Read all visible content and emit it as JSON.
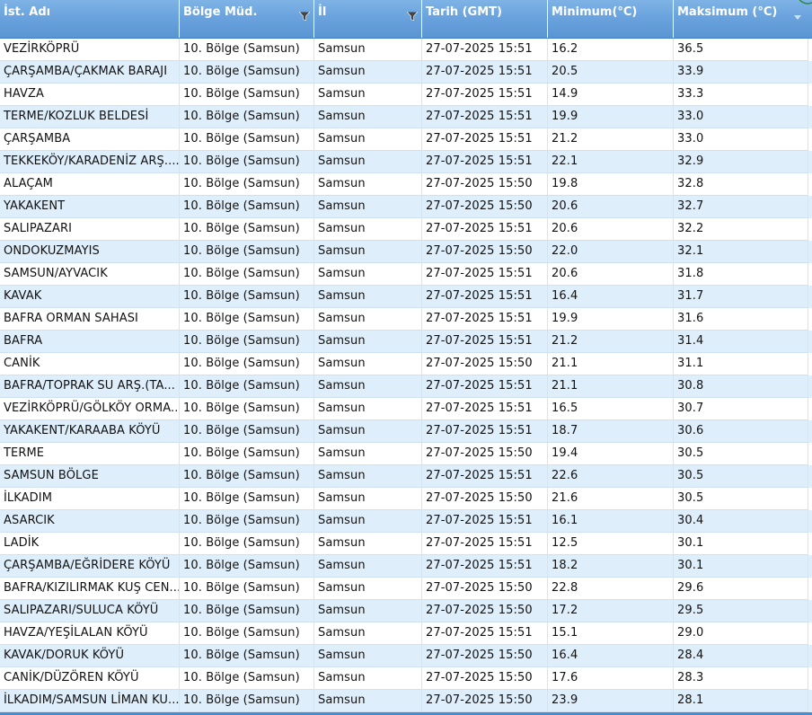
{
  "columns": [
    "İst. Adı",
    "Bölge Müd.",
    "İl",
    "Tarih (GMT)",
    "Minimum(°C)",
    "Maksimum (°C)"
  ],
  "rows": [
    [
      "VEZİRKÖPRÜ",
      "10. Bölge (Samsun)",
      "Samsun",
      "27-07-2025 15:51",
      "16.2",
      "36.5"
    ],
    [
      "ÇARŞAMBA/ÇAKMAK BARAJI",
      "10. Bölge (Samsun)",
      "Samsun",
      "27-07-2025 15:51",
      "20.5",
      "33.9"
    ],
    [
      "HAVZA",
      "10. Bölge (Samsun)",
      "Samsun",
      "27-07-2025 15:51",
      "14.9",
      "33.3"
    ],
    [
      "TERME/KOZLUK BELDESİ",
      "10. Bölge (Samsun)",
      "Samsun",
      "27-07-2025 15:51",
      "19.9",
      "33.0"
    ],
    [
      "ÇARŞAMBA",
      "10. Bölge (Samsun)",
      "Samsun",
      "27-07-2025 15:51",
      "21.2",
      "33.0"
    ],
    [
      "TEKKEKÖY/KARADENİZ ARŞ....",
      "10. Bölge (Samsun)",
      "Samsun",
      "27-07-2025 15:51",
      "22.1",
      "32.9"
    ],
    [
      "ALAÇAM",
      "10. Bölge (Samsun)",
      "Samsun",
      "27-07-2025 15:50",
      "19.8",
      "32.8"
    ],
    [
      "YAKAKENT",
      "10. Bölge (Samsun)",
      "Samsun",
      "27-07-2025 15:50",
      "20.6",
      "32.7"
    ],
    [
      "SALIPAZARI",
      "10. Bölge (Samsun)",
      "Samsun",
      "27-07-2025 15:51",
      "20.6",
      "32.2"
    ],
    [
      "ONDOKUZMAYIS",
      "10. Bölge (Samsun)",
      "Samsun",
      "27-07-2025 15:50",
      "22.0",
      "32.1"
    ],
    [
      "SAMSUN/AYVACIK",
      "10. Bölge (Samsun)",
      "Samsun",
      "27-07-2025 15:51",
      "20.6",
      "31.8"
    ],
    [
      "KAVAK",
      "10. Bölge (Samsun)",
      "Samsun",
      "27-07-2025 15:51",
      "16.4",
      "31.7"
    ],
    [
      "BAFRA ORMAN SAHASI",
      "10. Bölge (Samsun)",
      "Samsun",
      "27-07-2025 15:51",
      "19.9",
      "31.6"
    ],
    [
      "BAFRA",
      "10. Bölge (Samsun)",
      "Samsun",
      "27-07-2025 15:51",
      "21.2",
      "31.4"
    ],
    [
      "CANİK",
      "10. Bölge (Samsun)",
      "Samsun",
      "27-07-2025 15:50",
      "21.1",
      "31.1"
    ],
    [
      "BAFRA/TOPRAK SU ARŞ.(TA...",
      "10. Bölge (Samsun)",
      "Samsun",
      "27-07-2025 15:51",
      "21.1",
      "30.8"
    ],
    [
      "VEZİRKÖPRÜ/GÖLKÖY ORMA...",
      "10. Bölge (Samsun)",
      "Samsun",
      "27-07-2025 15:51",
      "16.5",
      "30.7"
    ],
    [
      "YAKAKENT/KARAABA KÖYÜ",
      "10. Bölge (Samsun)",
      "Samsun",
      "27-07-2025 15:51",
      "18.7",
      "30.6"
    ],
    [
      "TERME",
      "10. Bölge (Samsun)",
      "Samsun",
      "27-07-2025 15:50",
      "19.4",
      "30.5"
    ],
    [
      "SAMSUN BÖLGE",
      "10. Bölge (Samsun)",
      "Samsun",
      "27-07-2025 15:51",
      "22.6",
      "30.5"
    ],
    [
      "İLKADIM",
      "10. Bölge (Samsun)",
      "Samsun",
      "27-07-2025 15:50",
      "21.6",
      "30.5"
    ],
    [
      "ASARCIK",
      "10. Bölge (Samsun)",
      "Samsun",
      "27-07-2025 15:51",
      "16.1",
      "30.4"
    ],
    [
      "LADİK",
      "10. Bölge (Samsun)",
      "Samsun",
      "27-07-2025 15:51",
      "12.5",
      "30.1"
    ],
    [
      "ÇARŞAMBA/EĞRİDERE KÖYÜ",
      "10. Bölge (Samsun)",
      "Samsun",
      "27-07-2025 15:51",
      "18.2",
      "30.1"
    ],
    [
      "BAFRA/KIZILIRMAK KUŞ CEN...",
      "10. Bölge (Samsun)",
      "Samsun",
      "27-07-2025 15:50",
      "22.8",
      "29.6"
    ],
    [
      "SALIPAZARI/SULUCA KÖYÜ",
      "10. Bölge (Samsun)",
      "Samsun",
      "27-07-2025 15:50",
      "17.2",
      "29.5"
    ],
    [
      "HAVZA/YEŞİLALAN KÖYÜ",
      "10. Bölge (Samsun)",
      "Samsun",
      "27-07-2025 15:51",
      "15.1",
      "29.0"
    ],
    [
      "KAVAK/DORUK KÖYÜ",
      "10. Bölge (Samsun)",
      "Samsun",
      "27-07-2025 15:50",
      "16.4",
      "28.4"
    ],
    [
      "CANİK/DÜZÖREN KÖYÜ",
      "10. Bölge (Samsun)",
      "Samsun",
      "27-07-2025 15:50",
      "17.6",
      "28.3"
    ],
    [
      "İLKADIM/SAMSUN LİMAN KU...",
      "10. Bölge (Samsun)",
      "Samsun",
      "27-07-2025 15:50",
      "23.9",
      "28.1"
    ]
  ],
  "icons": {
    "filter": "funnel-filter-icon",
    "sort": "sort-desc-icon"
  },
  "colors": {
    "header": "#6aa3dd",
    "row_alt": "#dfeefb",
    "row": "#ffffff"
  }
}
